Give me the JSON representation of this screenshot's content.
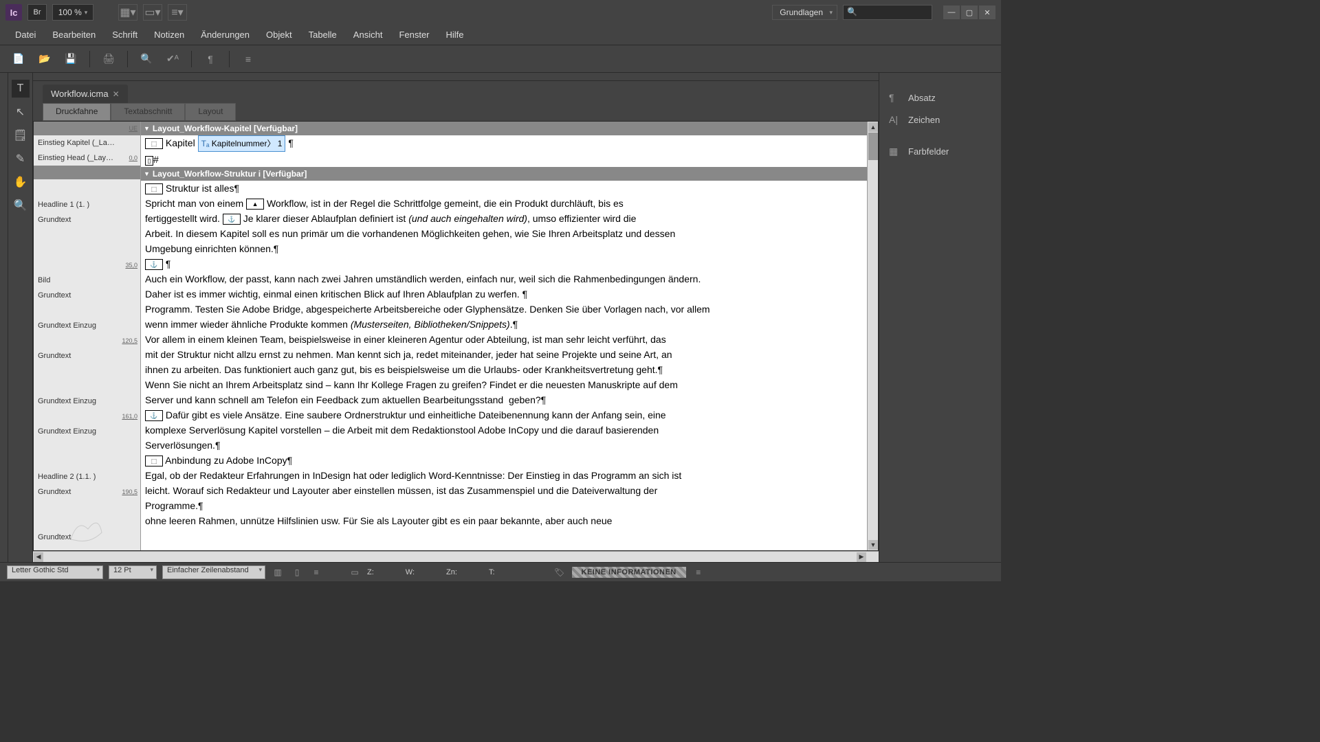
{
  "app": {
    "initials": "Ic",
    "bridge": "Br",
    "zoom": "100 %",
    "workspace": "Grundlagen"
  },
  "menus": [
    "Datei",
    "Bearbeiten",
    "Schrift",
    "Notizen",
    "Änderungen",
    "Objekt",
    "Tabelle",
    "Ansicht",
    "Fenster",
    "Hilfe"
  ],
  "doc": {
    "tab_title": "Workflow.icma"
  },
  "view_tabs": [
    "Druckfahne",
    "Textabschnitt",
    "Layout"
  ],
  "stories": {
    "kapitel": {
      "header": "Layout_Workflow-Kapitel  [Verfügbar]",
      "style_label": "Einstieg Kapitel (_La…",
      "chapter_word": "Kapitel",
      "var_name": "Kapitelnummer",
      "var_value": "1"
    },
    "struktur": {
      "header": "Layout_Workflow-Struktur i [Verfügbar]",
      "head_style": "Einstieg Head (_Lay…"
    }
  },
  "style_column": {
    "ue": "UE",
    "r0_0": "0,0",
    "h1": "Headline 1 (1. )",
    "grundtext": "Grundtext",
    "r35": "35,0",
    "bild": "Bild",
    "gt_einzug": "Grundtext Einzug",
    "r120": "120,5",
    "r161": "161,0",
    "h2": "Headline 2 (1.1. )",
    "r190": "190,5"
  },
  "body": {
    "struktur_heading": "Struktur ist alles¶",
    "p1a": "Spricht man von einem ",
    "p1b": "Workflow, ist in der Regel die Schrittfolge gemeint, die ein Produkt durchläuft, bis es",
    "p1c": "fertiggestellt wird. ",
    "p1d": "Je klarer dieser Ablaufplan definiert ist ",
    "p1d_ital": "(und auch eingehalten wird)",
    "p1e": ", umso effizienter wird die",
    "p1f": "Arbeit. In diesem Kapitel soll es nun primär um die vorhandenen Möglichkeiten gehen, wie Sie Ihren Arbeitsplatz und dessen",
    "p1g": "Umgebung einrichten können.¶",
    "p2a": "Auch ein Workflow, der passt, kann nach zwei Jahren umständlich werden, einfach nur, weil sich die Rahmenbedingungen ändern.",
    "p2b": "Daher ist es immer wichtig, einmal einen kritischen Blick auf Ihren Ablaufplan zu werfen. ¶",
    "p3a": "Programm. Testen Sie Adobe Bridge, abgespeicherte Arbeitsbereiche oder Glyphensätze. Denken Sie über Vorlagen nach, vor allem",
    "p3b": "wenn immer wieder ähnliche Produkte kommen ",
    "p3b_ital": "(Musterseiten, Bibliotheken/Snippets)",
    "p3c": ".¶",
    "p4a": "Vor allem in einem kleinen Team, beispielsweise in einer kleineren Agentur oder Abteilung, ist man sehr leicht verführt, das",
    "p4b": "mit der Struktur nicht allzu ernst zu nehmen. Man kennt sich ja, redet miteinander, jeder hat seine Projekte und seine Art, an",
    "p4c": "ihnen zu arbeiten. Das funktioniert auch ganz gut, bis es beispielsweise um die Urlaubs- oder Krankheitsvertretung geht.¶",
    "p5a": "Wenn Sie nicht an Ihrem Arbeitsplatz sind – kann Ihr Kollege Fragen zu greifen? Findet er die neuesten Manuskripte auf dem",
    "p5b": "Server und kann schnell am Telefon ein Feedback zum aktuellen Bearbeitungsstand  geben?¶",
    "p6a": "Dafür gibt es viele Ansätze. Eine saubere Ordnerstruktur und einheitliche Dateibenennung kann der Anfang sein, eine",
    "p6b": "komplexe Serverlösung Kapitel vorstellen – die Arbeit mit dem Redaktionstool Adobe InCopy und die darauf basierenden",
    "p6c": "Serverlösungen.¶",
    "h2": "Anbindung zu Adobe InCopy¶",
    "p7a": "Egal, ob der Redakteur Erfahrungen in InDesign hat oder lediglich Word-Kenntnisse: Der Einstieg in das Programm an sich ist",
    "p7b": "leicht. Worauf sich Redakteur und Layouter aber einstellen müssen, ist das Zusammenspiel und die Dateiverwaltung der",
    "p7c": "Programme.¶",
    "p8a": "ohne leeren Rahmen, unnütze Hilfslinien usw. Für Sie als Layouter gibt es ein paar bekannte, aber auch neue"
  },
  "right_panels": {
    "absatz": "Absatz",
    "zeichen": "Zeichen",
    "farbfelder": "Farbfelder"
  },
  "bottom": {
    "font": "Letter Gothic Std",
    "size": "12 Pt",
    "leading": "Einfacher Zeilenabstand",
    "z_label": "Z:",
    "w_label": "W:",
    "zn_label": "Zn:",
    "t_label": "T:",
    "status": "KEINE INFORMATIONEN"
  }
}
